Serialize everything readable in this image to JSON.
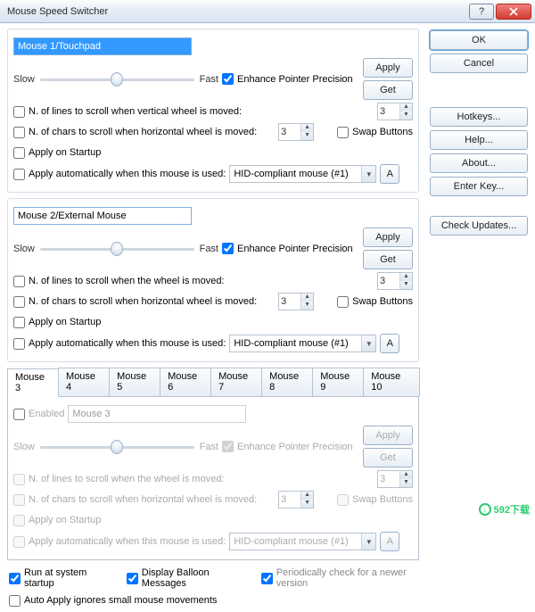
{
  "window": {
    "title": "Mouse Speed Switcher"
  },
  "side": {
    "ok": "OK",
    "cancel": "Cancel",
    "hotkeys": "Hotkeys...",
    "help": "Help...",
    "about": "About...",
    "enterkey": "Enter Key...",
    "updates": "Check Updates..."
  },
  "common": {
    "slow": "Slow",
    "fast": "Fast",
    "enhance": "Enhance Pointer Precision",
    "apply": "Apply",
    "get": "Get",
    "swap": "Swap Buttons",
    "apply_startup": "Apply on Startup",
    "apply_auto": "Apply automatically when this mouse is used:",
    "device": "HID-compliant mouse (#1)",
    "a_btn": "A"
  },
  "m1": {
    "name": "Mouse 1/Touchpad",
    "lines_check": "N. of lines to scroll when vertical wheel is moved:",
    "chars_check": "N. of chars to scroll when  horizontal wheel is moved:",
    "lines_val": "3",
    "chars_val": "3"
  },
  "m2": {
    "name": "Mouse 2/External Mouse",
    "lines_check": "N. of lines to scroll when the wheel is moved:",
    "chars_check": "N. of chars to scroll when  horizontal wheel is moved:",
    "lines_val": "3",
    "chars_val": "3"
  },
  "tabs": [
    "Mouse 3",
    "Mouse 4",
    "Mouse 5",
    "Mouse 6",
    "Mouse 7",
    "Mouse 8",
    "Mouse 9",
    "Mouse 10"
  ],
  "m3": {
    "enabled_lbl": "Enabled",
    "name": "Mouse 3",
    "lines_check": "N. of lines to scroll when the wheel is moved:",
    "chars_check": "N. of chars to scroll when  horizontal wheel is moved:",
    "lines_val": "3",
    "chars_val": "3"
  },
  "footer": {
    "run_startup": "Run at system startup",
    "balloon": "Display Balloon Messages",
    "periodic": "Periodically check for a newer version",
    "auto_apply": "Auto Apply ignores small mouse movements"
  },
  "watermark": "592下载"
}
